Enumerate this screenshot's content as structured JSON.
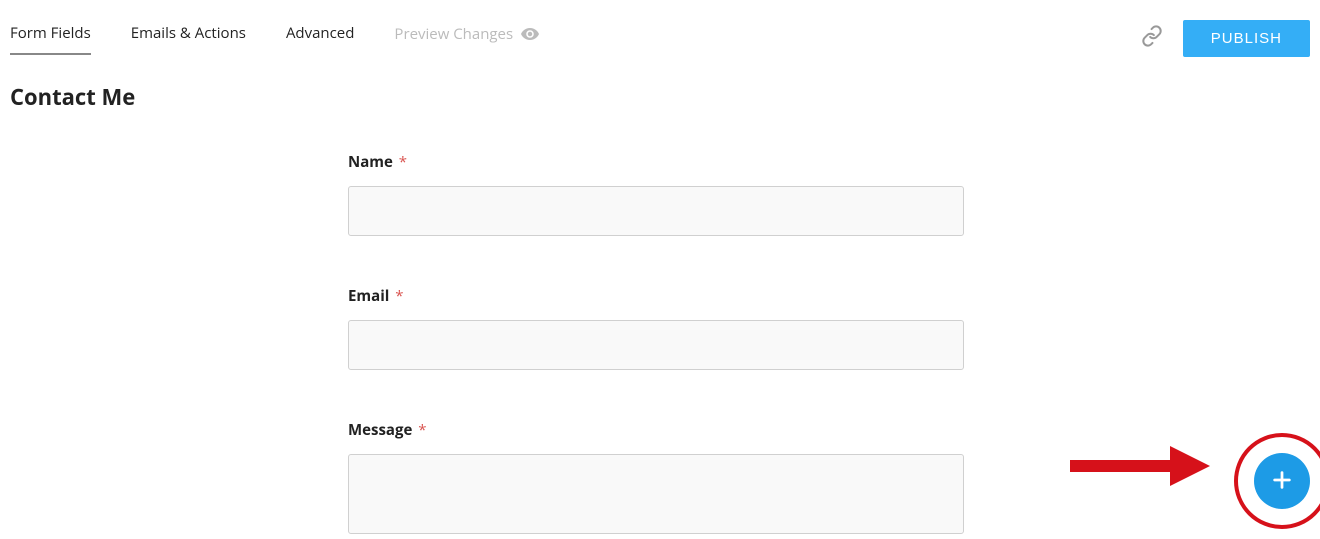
{
  "tabs": {
    "form_fields": "Form Fields",
    "emails_actions": "Emails & Actions",
    "advanced": "Advanced",
    "preview_changes": "Preview Changes"
  },
  "buttons": {
    "publish": "PUBLISH"
  },
  "form": {
    "title": "Contact Me",
    "fields": {
      "name": {
        "label": "Name",
        "required": "*"
      },
      "email": {
        "label": "Email",
        "required": "*"
      },
      "message": {
        "label": "Message",
        "required": "*"
      }
    }
  }
}
